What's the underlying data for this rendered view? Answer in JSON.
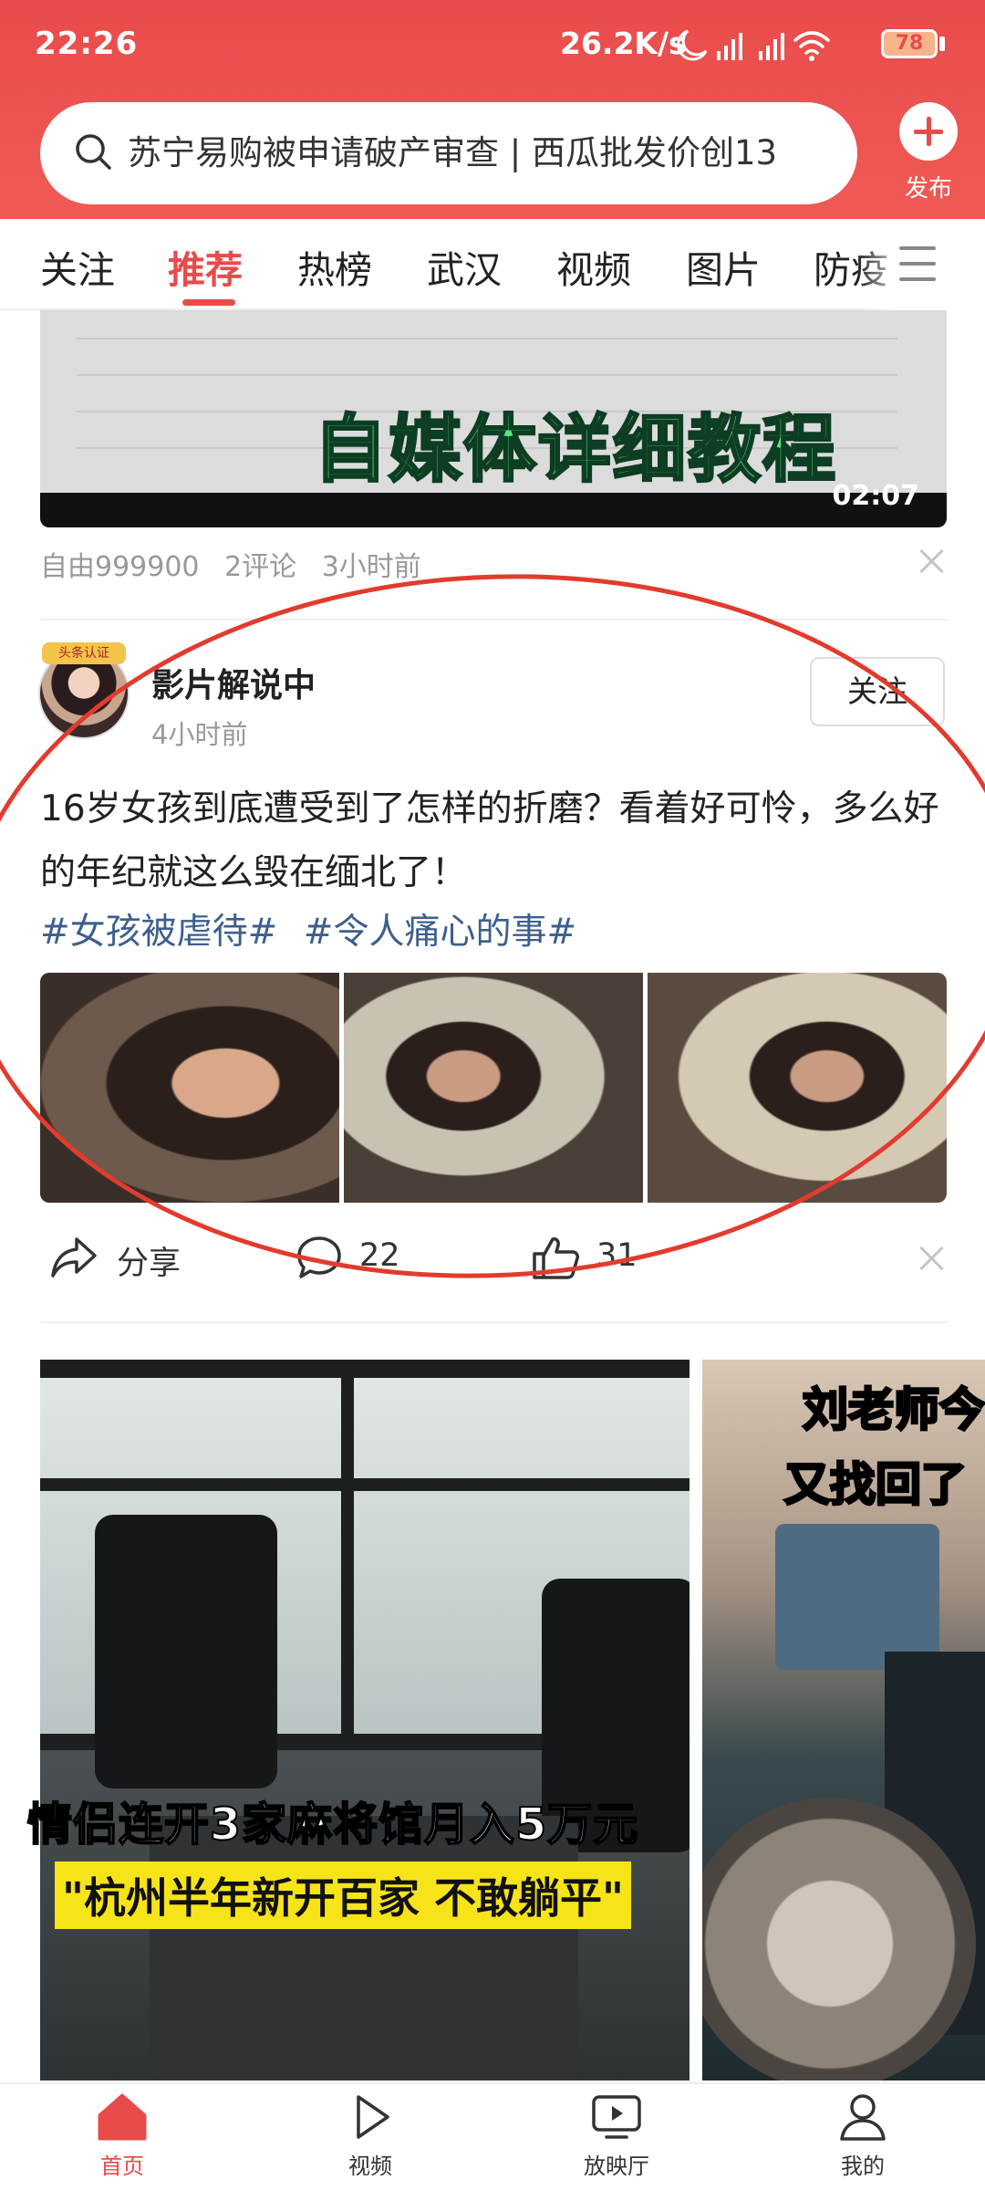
{
  "status_bar": {
    "time": "22:26",
    "network_speed": "26.2K/s",
    "battery": "78"
  },
  "search": {
    "query": "苏宁易购被申请破产审查 | 西瓜批发价创13"
  },
  "publish": {
    "label": "发布"
  },
  "tabs": [
    {
      "label": "关注"
    },
    {
      "label": "推荐"
    },
    {
      "label": "热榜"
    },
    {
      "label": "武汉"
    },
    {
      "label": "视频"
    },
    {
      "label": "图片"
    },
    {
      "label": "防疫"
    }
  ],
  "video_card": {
    "overlay_title": "自媒体详细教程",
    "duration": "02:07",
    "author": "自由999900",
    "comments": "2评论",
    "time": "3小时前"
  },
  "post": {
    "avatar_badge": "头条认证",
    "author": "影片解说中",
    "time": "4小时前",
    "follow_label": "关注",
    "text": "16岁女孩到底遭受到了怎样的折磨？看着好可怜，多么好的年纪就这么毁在缅北了！",
    "tags": [
      "#女孩被虐待#",
      "#令人痛心的事#"
    ],
    "share_label": "分享",
    "comment_count": "22",
    "like_count": "31"
  },
  "feed_cards": [
    {
      "caption_line1": "情侣连开3家麻将馆月入5万元",
      "caption_line2": "\"杭州半年新开百家 不敢躺平\""
    },
    {
      "caption_line1": "刘老师今",
      "caption_line2": "又找回了"
    }
  ],
  "bottom_nav": [
    {
      "label": "首页",
      "icon": "home-icon"
    },
    {
      "label": "视频",
      "icon": "play-icon"
    },
    {
      "label": "放映厅",
      "icon": "screen-icon"
    },
    {
      "label": "我的",
      "icon": "user-icon"
    }
  ],
  "colors": {
    "brand": "#e94b4b",
    "tag": "#3d5f8d",
    "annotation": "#e23b2e"
  }
}
